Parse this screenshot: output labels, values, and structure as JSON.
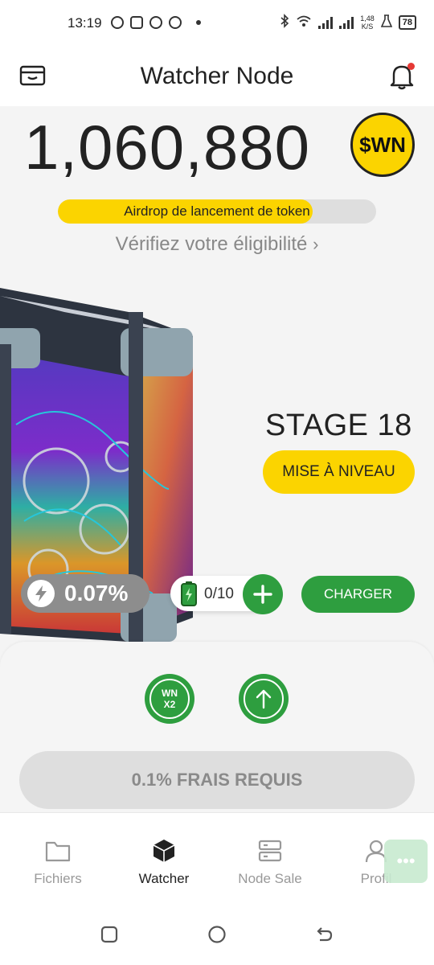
{
  "status_bar": {
    "time": "13:19",
    "net_speed_value": "1,48",
    "net_speed_unit": "K/S",
    "battery": "78"
  },
  "header": {
    "title": "Watcher Node"
  },
  "balance": {
    "amount": "1,060,880",
    "token_symbol": "$WN"
  },
  "airdrop": {
    "label": "Airdrop de lancement de token",
    "progress": 0.8
  },
  "eligibility_link": "Vérifiez votre éligibilité",
  "stage": {
    "label": "STAGE 18",
    "upgrade_label": "MISE À NIVEAU"
  },
  "mining": {
    "rate": "0.07%",
    "battery_count": "0/10",
    "charge_label": "CHARGER"
  },
  "boosts": [
    {
      "line1": "WN",
      "line2": "X2"
    }
  ],
  "fee_button": "0.1% FRAIS REQUIS",
  "nav": {
    "items": [
      {
        "label": "Fichiers",
        "icon": "folder-icon"
      },
      {
        "label": "Watcher",
        "icon": "cube-icon"
      },
      {
        "label": "Node Sale",
        "icon": "server-icon"
      },
      {
        "label": "Profil",
        "icon": "user-icon"
      }
    ],
    "active": "Watcher"
  },
  "colors": {
    "accent_yellow": "#fbd400",
    "accent_green": "#2e9e3f",
    "notification_red": "#e53935"
  }
}
